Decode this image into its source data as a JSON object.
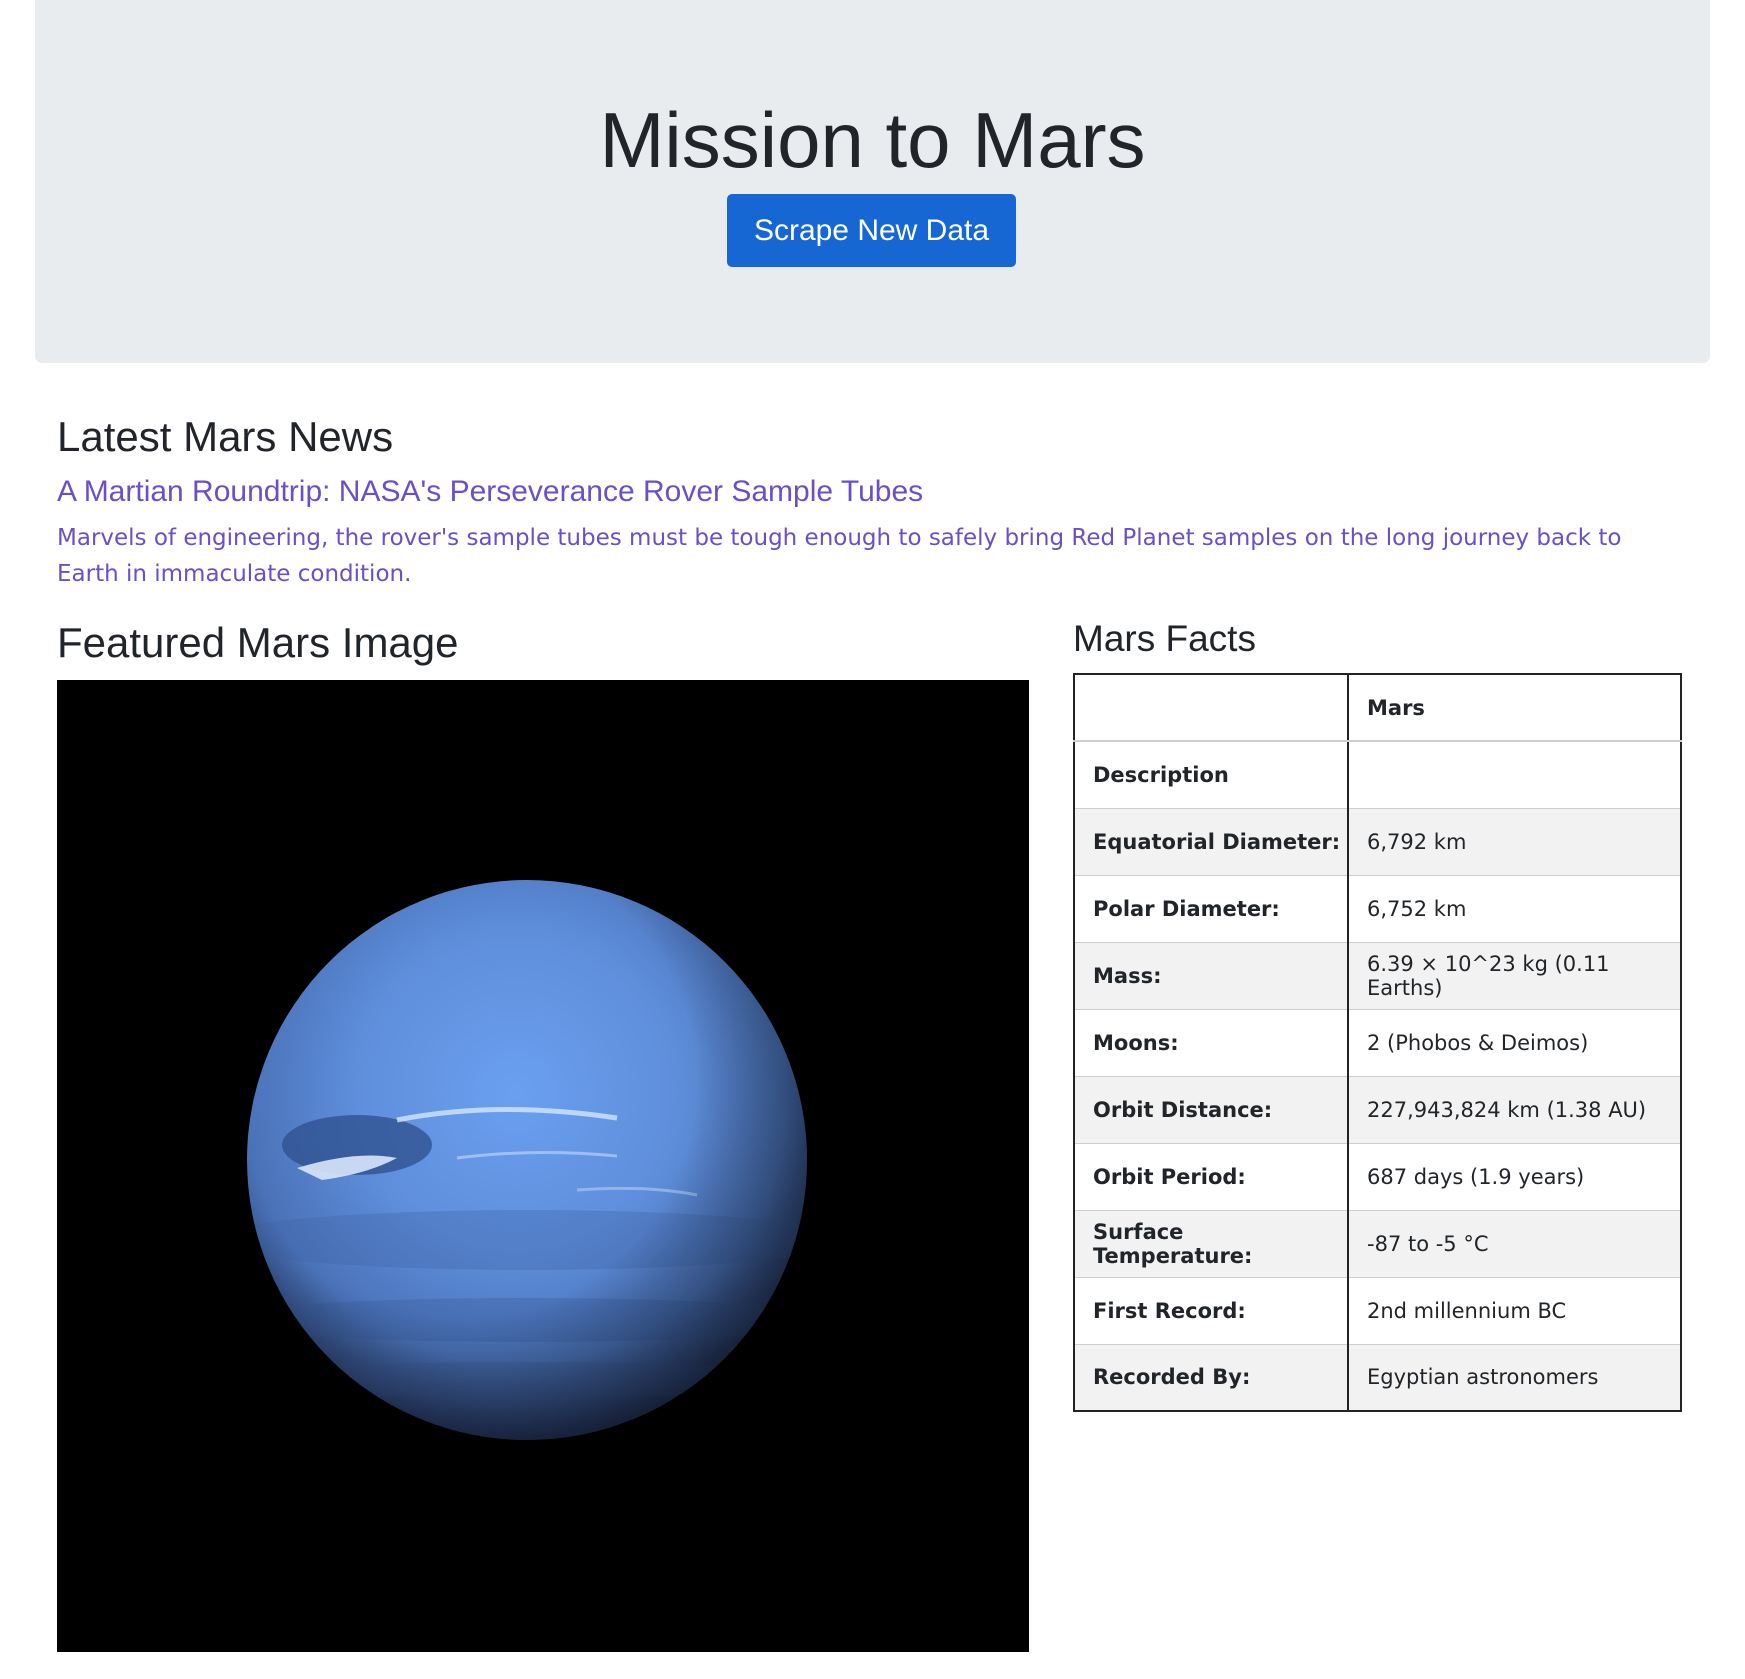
{
  "header": {
    "title": "Mission to Mars",
    "scrape_button_label": "Scrape New Data"
  },
  "news": {
    "heading": "Latest Mars News",
    "title": "A Martian Roundtrip: NASA's Perseverance Rover Sample Tubes",
    "teaser": "Marvels of engineering, the rover's sample tubes must be tough enough to safely bring Red Planet samples on the long journey back to Earth in immaculate condition."
  },
  "featured_image": {
    "heading": "Featured Mars Image",
    "subject": "blue-planet-photo"
  },
  "facts": {
    "heading": "Mars Facts",
    "columns": [
      "",
      "Mars"
    ],
    "rows": [
      {
        "label": "Description",
        "value": ""
      },
      {
        "label": "Equatorial Diameter:",
        "value": "6,792 km"
      },
      {
        "label": "Polar Diameter:",
        "value": "6,752 km"
      },
      {
        "label": "Mass:",
        "value": "6.39 × 10^23 kg (0.11 Earths)"
      },
      {
        "label": "Moons:",
        "value": "2 (Phobos & Deimos)"
      },
      {
        "label": "Orbit Distance:",
        "value": "227,943,824 km (1.38 AU)"
      },
      {
        "label": "Orbit Period:",
        "value": "687 days (1.9 years)"
      },
      {
        "label": "Surface Temperature:",
        "value": "-87 to -5 °C"
      },
      {
        "label": "First Record:",
        "value": "2nd millennium BC"
      },
      {
        "label": "Recorded By:",
        "value": "Egyptian astronomers"
      }
    ]
  },
  "colors": {
    "jumbotron_bg": "#e9ecef",
    "button_bg": "#1666d4",
    "link": "#6a4fc9",
    "text": "#212529"
  }
}
